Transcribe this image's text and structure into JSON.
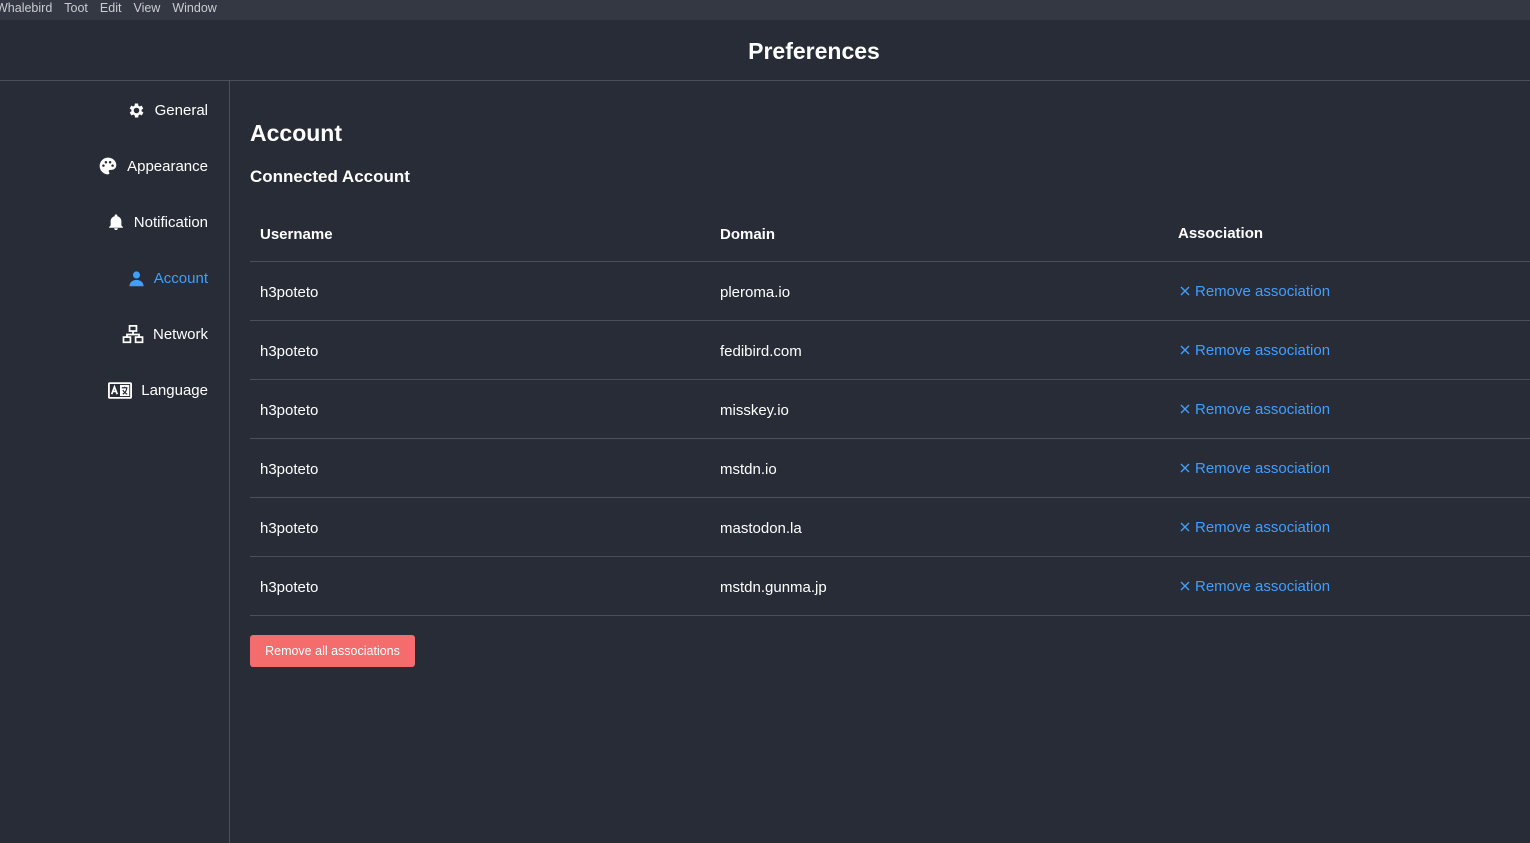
{
  "menubar": {
    "items": [
      "Whalebird",
      "Toot",
      "Edit",
      "View",
      "Window"
    ]
  },
  "header": {
    "title": "Preferences"
  },
  "sidebar": {
    "items": [
      {
        "label": "General",
        "icon": "gear-icon"
      },
      {
        "label": "Appearance",
        "icon": "palette-icon"
      },
      {
        "label": "Notification",
        "icon": "bell-icon"
      },
      {
        "label": "Account",
        "icon": "user-icon",
        "active": true
      },
      {
        "label": "Network",
        "icon": "network-icon"
      },
      {
        "label": "Language",
        "icon": "language-icon"
      }
    ]
  },
  "main": {
    "title": "Account",
    "section_title": "Connected Account",
    "table": {
      "columns": [
        "Username",
        "Domain",
        "Association"
      ],
      "rows": [
        {
          "username": "h3poteto",
          "domain": "pleroma.io",
          "action": "Remove association"
        },
        {
          "username": "h3poteto",
          "domain": "fedibird.com",
          "action": "Remove association"
        },
        {
          "username": "h3poteto",
          "domain": "misskey.io",
          "action": "Remove association"
        },
        {
          "username": "h3poteto",
          "domain": "mstdn.io",
          "action": "Remove association"
        },
        {
          "username": "h3poteto",
          "domain": "mastodon.la",
          "action": "Remove association"
        },
        {
          "username": "h3poteto",
          "domain": "mstdn.gunma.jp",
          "action": "Remove association"
        }
      ]
    },
    "remove_all_label": "Remove all associations"
  },
  "colors": {
    "background": "#282c37",
    "accent": "#409eff",
    "danger": "#f56c6c",
    "divider": "#4a4f5a"
  }
}
